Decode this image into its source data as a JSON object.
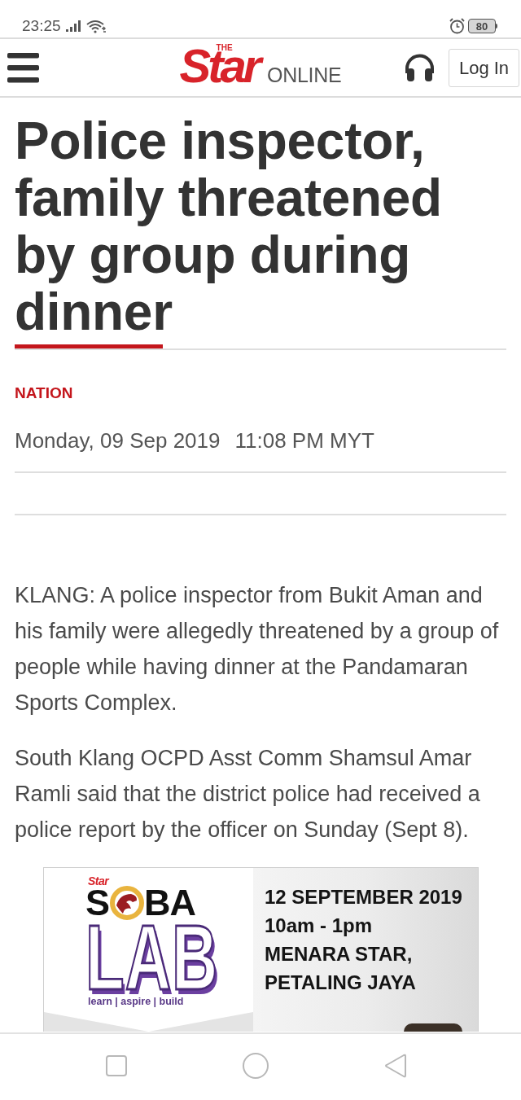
{
  "status_bar": {
    "time": "23:25",
    "battery": "80"
  },
  "header": {
    "logo": {
      "tag": "THE",
      "name": "Star",
      "suffix": "ONLINE"
    },
    "login_button": "Log In"
  },
  "article": {
    "title": "Police inspector, family threatened by group during dinner",
    "category": "NATION",
    "date": "Monday, 09 Sep 2019",
    "time": "11:08 PM MYT",
    "paragraphs": [
      "KLANG: A police inspector from Bukit Aman and his family were allegedly threatened by a group of people while having dinner at the Pandamaran Sports Complex.",
      "South Klang OCPD Asst Comm Shamsul Amar Ramli said that the district police had received a police report by the officer on Sunday (Sept 8)."
    ]
  },
  "ad": {
    "brand": "Star",
    "logo_left": "S",
    "logo_right": "BA",
    "logo_bottom": "LAB",
    "tagline": "learn | aspire | build",
    "details": [
      "12 SEPTEMBER 2019",
      "10am - 1pm",
      "MENARA STAR,",
      "PETALING JAYA"
    ]
  }
}
